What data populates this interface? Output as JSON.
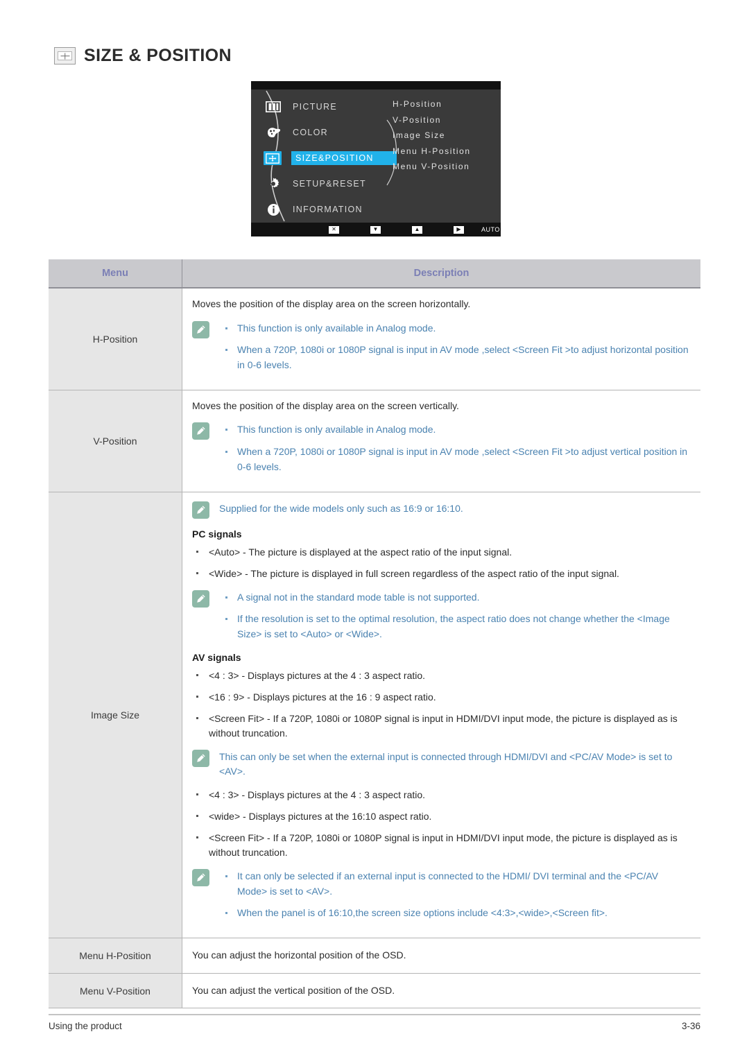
{
  "heading": {
    "icon": "size-position-icon",
    "title": "SIZE & POSITION"
  },
  "osd": {
    "left_menu": [
      {
        "icon": "picture-icon",
        "label": "PICTURE",
        "selected": false
      },
      {
        "icon": "color-icon",
        "label": "COLOR",
        "selected": false
      },
      {
        "icon": "size-position-icon",
        "label": "SIZE&POSITION",
        "selected": true
      },
      {
        "icon": "gear-icon",
        "label": "SETUP&RESET",
        "selected": false
      },
      {
        "icon": "information-icon",
        "label": "INFORMATION",
        "selected": false
      }
    ],
    "right_menu": [
      "H-Position",
      "V-Position",
      "Image Size",
      "Menu H-Position",
      "Menu V-Position"
    ],
    "bottom_bar": [
      {
        "icon": "close-icon",
        "label": "✕"
      },
      {
        "icon": "down-arrow-icon",
        "label": "▼"
      },
      {
        "icon": "up-arrow-icon",
        "label": "▲"
      },
      {
        "icon": "right-arrow-icon",
        "label": "▶"
      },
      {
        "icon": "auto-icon",
        "label": "AUTO"
      },
      {
        "icon": "power-icon",
        "label": "⏻"
      }
    ],
    "highlight_color": "#21b2ea"
  },
  "table": {
    "headers": {
      "menu": "Menu",
      "description": "Description"
    },
    "rows": {
      "h_position": {
        "menu": "H-Position",
        "intro": "Moves the position of the display area on the screen horizontally.",
        "notes": [
          "This function is only available in Analog mode.",
          "When a 720P, 1080i or 1080P signal is input in AV mode ,select <Screen Fit  >to adjust horizontal position in 0-6 levels."
        ]
      },
      "v_position": {
        "menu": "V-Position",
        "intro": "Moves the position of the display area on the screen vertically.",
        "notes": [
          "This function is only available in Analog mode.",
          "When a 720P, 1080i or 1080P signal is input in AV mode ,select <Screen Fit  >to adjust vertical position in 0-6 levels."
        ]
      },
      "image_size": {
        "menu": "Image Size",
        "note_top": "Supplied for the wide models only such as 16:9 or 16:10.",
        "pc_signals_head": "PC signals",
        "pc_signals": [
          "<Auto> - The picture is displayed at the aspect ratio of the input signal.",
          "<Wide> - The picture is displayed in full screen regardless of the aspect ratio of the input signal."
        ],
        "pc_notes": [
          "A signal not in the standard mode table is not supported.",
          "If the resolution is set to the optimal resolution, the aspect ratio does not change whether the <Image Size> is set to <Auto> or <Wide>."
        ],
        "av_signals_head": "AV signals",
        "av_signals": [
          "<4 : 3> - Displays pictures at the 4 : 3 aspect ratio.",
          "<16 : 9> - Displays pictures at the 16 : 9 aspect ratio.",
          "<Screen Fit> - If a 720P, 1080i or 1080P signal is input in HDMI/DVI input mode, the picture is displayed as is without truncation."
        ],
        "av_note": "This can only be set when the external input is connected through HDMI/DVI and <PC/AV Mode> is set to <AV>.",
        "av_signals2": [
          "<4 : 3> - Displays pictures at the 4 : 3 aspect ratio.",
          "<wide> - Displays pictures at the 16:10 aspect ratio.",
          "<Screen Fit> - If a 720P, 1080i or 1080P signal is input in HDMI/DVI input mode, the picture is displayed as is without truncation."
        ],
        "av_notes2": [
          "It can only be selected if an external input is connected to the HDMI/ DVI terminal and the <PC/AV Mode> is set to <AV>.",
          "When the panel is of 16:10,the screen size options include <4:3>,<wide>,<Screen fit>."
        ]
      },
      "menu_h_position": {
        "menu": "Menu H-Position",
        "description": "You can adjust the horizontal position of the OSD."
      },
      "menu_v_position": {
        "menu": "Menu V-Position",
        "description": "You can adjust the vertical position of the OSD."
      }
    }
  },
  "footer": {
    "left": "Using the product",
    "right": "3-36"
  },
  "colors": {
    "note_text": "#4a82b0",
    "note_icon_bg": "#8db8a7",
    "table_header_bg": "#c9c9cd",
    "table_header_text": "#7b7fb5",
    "menu_cell_bg": "#e6e6e6",
    "osd_highlight": "#21b2ea"
  }
}
